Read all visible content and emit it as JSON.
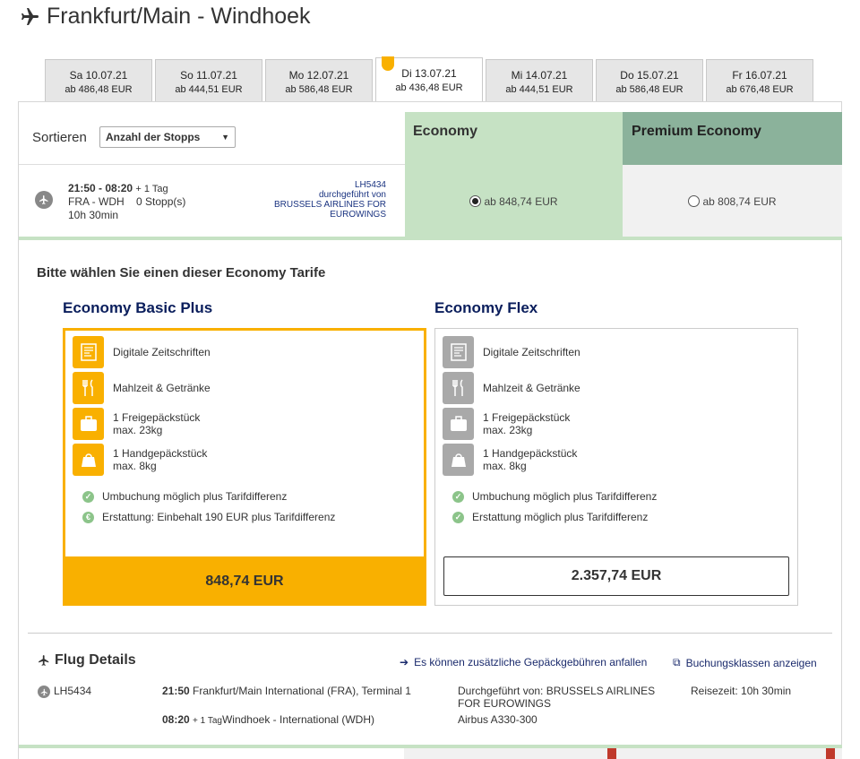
{
  "header": {
    "title": "Frankfurt/Main - Windhoek",
    "icon": "plane-icon"
  },
  "date_tabs": [
    {
      "day": "Sa 10.07.21",
      "price": "ab 486,48 EUR",
      "active": false
    },
    {
      "day": "So 11.07.21",
      "price": "ab 444,51 EUR",
      "active": false
    },
    {
      "day": "Mo 12.07.21",
      "price": "ab 586,48 EUR",
      "active": false
    },
    {
      "day": "Di 13.07.21",
      "price": "ab 436,48 EUR",
      "active": true
    },
    {
      "day": "Mi 14.07.21",
      "price": "ab 444,51 EUR",
      "active": false
    },
    {
      "day": "Do 15.07.21",
      "price": "ab 586,48 EUR",
      "active": false
    },
    {
      "day": "Fr 16.07.21",
      "price": "ab 676,48 EUR",
      "active": false
    }
  ],
  "sort": {
    "label": "Sortieren",
    "selected": "Anzahl der Stopps"
  },
  "columns": {
    "economy": "Economy",
    "premium": "Premium Economy"
  },
  "flight": {
    "times": "21:50 - 08:20",
    "plus_day": "+ 1 Tag",
    "route": "FRA - WDH",
    "stops": "0 Stopp(s)",
    "duration": "10h 30min",
    "flight_no": "LH5434",
    "operated_by": "durchgeführt von",
    "operator": "BRUSSELS AIRLINES FOR EUROWINGS",
    "economy_price": "ab 848,74 EUR",
    "premium_price": "ab 808,74 EUR"
  },
  "fares": {
    "heading": "Bitte wählen Sie einen dieser Economy Tarife",
    "basic": {
      "title": "Economy Basic Plus",
      "features": [
        {
          "line1": "Digitale Zeitschriften",
          "line2": ""
        },
        {
          "line1": "Mahlzeit & Getränke",
          "line2": ""
        },
        {
          "line1": "1 Freigepäckstück",
          "line2": "max. 23kg"
        },
        {
          "line1": "1 Handgepäckstück",
          "line2": "max. 8kg"
        }
      ],
      "conditions": [
        "Umbuchung möglich plus Tarifdifferenz",
        "Erstattung: Einbehalt 190 EUR plus Tarifdifferenz"
      ],
      "price": "848,74 EUR"
    },
    "flex": {
      "title": "Economy Flex",
      "features": [
        {
          "line1": "Digitale Zeitschriften",
          "line2": ""
        },
        {
          "line1": "Mahlzeit & Getränke",
          "line2": ""
        },
        {
          "line1": "1 Freigepäckstück",
          "line2": "max. 23kg"
        },
        {
          "line1": "1 Handgepäckstück",
          "line2": "max. 8kg"
        }
      ],
      "conditions": [
        "Umbuchung möglich plus Tarifdifferenz",
        "Erstattung möglich plus Tarifdifferenz"
      ],
      "price": "2.357,74 EUR"
    }
  },
  "details": {
    "title": "Flug Details",
    "link_baggage": "Es können zusätzliche Gepäckgebühren anfallen",
    "link_classes": "Buchungsklassen anzeigen",
    "flight_no": "LH5434",
    "dep_time": "21:50",
    "dep_airport": "Frankfurt/Main International (FRA), Terminal 1",
    "arr_time": "08:20",
    "arr_plus": "+ 1 Tag",
    "arr_airport": "Windhoek - International (WDH)",
    "operated": "Durchgeführt von: BRUSSELS AIRLINES FOR EUROWINGS",
    "aircraft": "Airbus A330-300",
    "travel_time": "Reisezeit: 10h 30min"
  },
  "colors": {
    "accent_yellow": "#f9b000",
    "economy_green": "#c6e2c4",
    "premium_green": "#8bb29b",
    "navy": "#0a1e5c"
  }
}
